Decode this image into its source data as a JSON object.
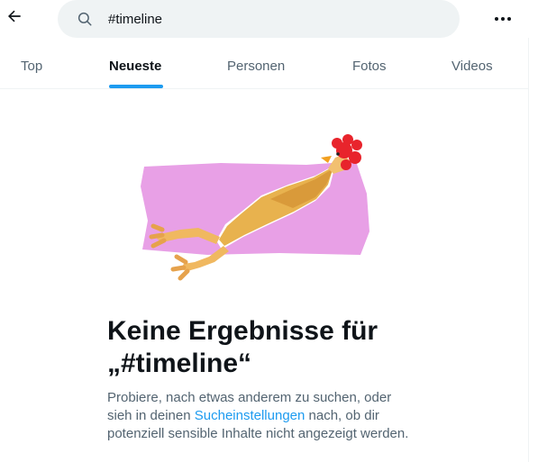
{
  "search": {
    "value": "#timeline",
    "back_icon": "arrow-left-icon",
    "search_icon": "search-icon",
    "more_icon": "more-horizontal-icon"
  },
  "tabs": [
    {
      "label": "Top",
      "active": false
    },
    {
      "label": "Neueste",
      "active": true
    },
    {
      "label": "Personen",
      "active": false
    },
    {
      "label": "Fotos",
      "active": false
    },
    {
      "label": "Videos",
      "active": false
    }
  ],
  "empty_state": {
    "illustration": "rubber-chicken-illustration",
    "title": "Keine Ergebnisse für „#timeline“",
    "desc_before": "Probiere, nach etwas anderem zu suchen, oder sieh in deinen ",
    "desc_link": "Sucheinstellungen",
    "desc_after": " nach, ob dir potenziell sensible Inhalte nicht angezeigt werden."
  },
  "colors": {
    "accent": "#1d9bf0",
    "text_primary": "#0f1419",
    "text_secondary": "#536471",
    "search_bg": "#eff3f4",
    "illustration_pink": "#e8a0e6"
  }
}
